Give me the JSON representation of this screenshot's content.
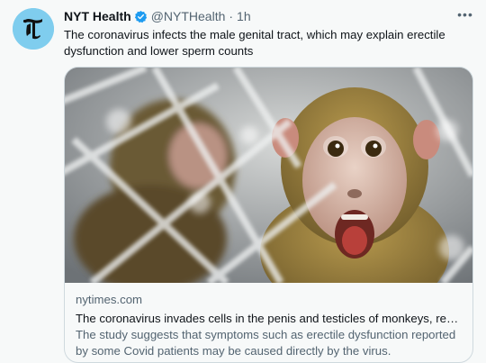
{
  "tweet": {
    "author_name": "NYT Health",
    "handle": "@NYTHealth",
    "separator": "·",
    "time": "1h",
    "more_label": "•••",
    "text": "The coronavirus infects the male genital tract, which may explain erectile dysfunction and lower sperm counts"
  },
  "avatar": {
    "icon": "nyt-logo-icon",
    "color": "#7fcdee"
  },
  "verified": {
    "icon": "verified-badge-icon",
    "color": "#1d9bf0"
  },
  "card": {
    "domain": "nytimes.com",
    "title": "The coronavirus invades cells in the penis and testicles of monkeys, researchers found.",
    "description": "The study suggests that symptoms such as erectile dysfunction reported by some Covid patients may be caused directly by the virus.",
    "image": "photo of rhesus monkeys behind a cage fence"
  },
  "colors": {
    "background": "#f7f9f9",
    "text": "#0f1419",
    "secondary_text": "#536471",
    "border": "#cfd9de"
  }
}
